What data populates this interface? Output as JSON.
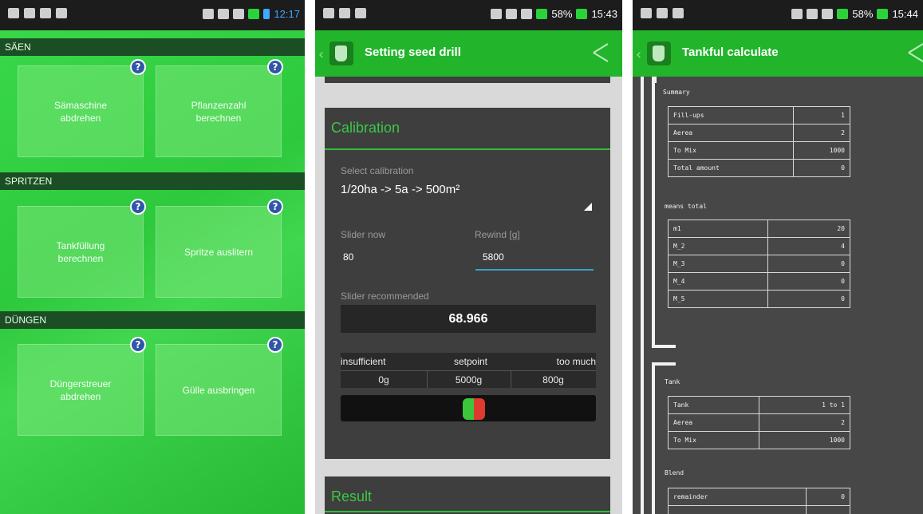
{
  "screen1": {
    "status_time": "12:17",
    "sections": [
      {
        "header": "SÄEN",
        "tiles": [
          "Sämaschine\nabdrehen",
          "Pflanzenzahl\nberechnen"
        ]
      },
      {
        "header": "SPRITZEN",
        "tiles": [
          "Tankfüllung\nberechnen",
          "Spritze auslitern"
        ]
      },
      {
        "header": "DÜNGEN",
        "tiles": [
          "Düngerstreuer\nabdrehen",
          "Gülle ausbringen"
        ]
      }
    ],
    "help_glyph": "?"
  },
  "screen2": {
    "status": {
      "battery": "58%",
      "time": "15:43"
    },
    "title": "Setting seed drill",
    "calibration_title": "Calibration",
    "select_label": "Select calibration",
    "select_value": "1/20ha -> 5a -> 500m²",
    "slider_now_label": "Slider now",
    "slider_now_value": "80",
    "rewind_label": "Rewind [g]",
    "rewind_value": "5800",
    "slider_recommended_label": "Slider recommended",
    "slider_recommended_value": "68.966",
    "range_headers": [
      "insufficient",
      "setpoint",
      "too much"
    ],
    "range_values": [
      "0g",
      "5000g",
      "800g"
    ],
    "result_title": "Result",
    "colors": {
      "accent": "#22b52c",
      "indicator_green": "#3cc63c",
      "indicator_red": "#e03a2f"
    }
  },
  "screen3": {
    "status": {
      "battery": "58%",
      "time": "15:44"
    },
    "title": "Tankful calculate",
    "summary_label": "Summary",
    "summary_rows": [
      [
        "Fill-ups",
        "1"
      ],
      [
        "Aerea",
        "2"
      ],
      [
        "To Mix",
        "1000"
      ],
      [
        "Total amount",
        "0"
      ]
    ],
    "means_label": "means total",
    "means_rows": [
      [
        "m1",
        "20"
      ],
      [
        "M_2",
        "4"
      ],
      [
        "M_3",
        "0"
      ],
      [
        "M_4",
        "0"
      ],
      [
        "M_5",
        "0"
      ]
    ],
    "tank_label": "Tank",
    "tank_rows": [
      [
        "Tank",
        "1 to 1"
      ],
      [
        "Aerea",
        "2"
      ],
      [
        "To Mix",
        "1000"
      ]
    ],
    "blend_label": "Blend",
    "blend_rows": [
      [
        "remainder",
        "0"
      ]
    ]
  }
}
